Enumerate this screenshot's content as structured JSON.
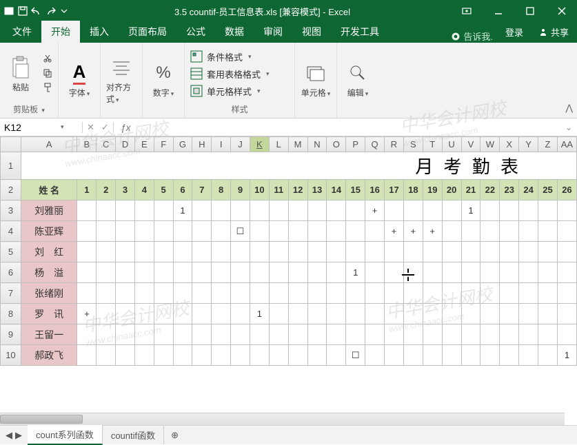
{
  "title": "3.5 countif-员工信息表.xls [兼容模式] - Excel",
  "tabs": {
    "file": "文件",
    "home": "开始",
    "insert": "插入",
    "layout": "页面布局",
    "formulas": "公式",
    "data": "数据",
    "review": "审阅",
    "view": "视图",
    "developer": "开发工具",
    "tellme": "告诉我.",
    "signin": "登录",
    "share": "共享"
  },
  "ribbon": {
    "paste": "粘贴",
    "clipboard": "剪贴板",
    "font": "字体",
    "alignment": "对齐方式",
    "number": "数字",
    "conditional": "条件格式",
    "tableformat": "套用表格格式",
    "cellstyles": "单元格样式",
    "styles": "样式",
    "cells": "单元格",
    "editing": "编辑"
  },
  "namebox": "K12",
  "columns": [
    "A",
    "B",
    "C",
    "D",
    "E",
    "F",
    "G",
    "H",
    "I",
    "J",
    "K",
    "L",
    "M",
    "N",
    "O",
    "P",
    "Q",
    "R",
    "S",
    "T",
    "U",
    "V",
    "W",
    "X",
    "Y",
    "Z",
    "AA"
  ],
  "title_row": "月 考 勤 表",
  "header_name": "姓 名",
  "days": [
    "1",
    "2",
    "3",
    "4",
    "5",
    "6",
    "7",
    "8",
    "9",
    "10",
    "11",
    "12",
    "13",
    "14",
    "15",
    "16",
    "17",
    "18",
    "19",
    "20",
    "21",
    "22",
    "23",
    "24",
    "25",
    "26"
  ],
  "rows": [
    {
      "name": "刘雅丽",
      "cells": {
        "6": "1",
        "16": "+",
        "21": "1"
      }
    },
    {
      "name": "陈亚辉",
      "cells": {
        "9": "☐",
        "17": "+",
        "18": "+",
        "19": "+"
      }
    },
    {
      "name": "刘　红",
      "cells": {}
    },
    {
      "name": "杨　溢",
      "cells": {
        "15": "1"
      }
    },
    {
      "name": "张绪刚",
      "cells": {}
    },
    {
      "name": "罗　讯",
      "cells": {
        "1": "+",
        "10": "1"
      }
    },
    {
      "name": "王留一",
      "cells": {}
    },
    {
      "name": "郝政飞",
      "cells": {
        "15": "☐",
        "26": "1"
      }
    }
  ],
  "sheets": {
    "tab1": "count系列函数",
    "tab2": "countif函数"
  },
  "watermark": {
    "main": "中华会计网校",
    "sub": "www.chinaacc.com"
  }
}
